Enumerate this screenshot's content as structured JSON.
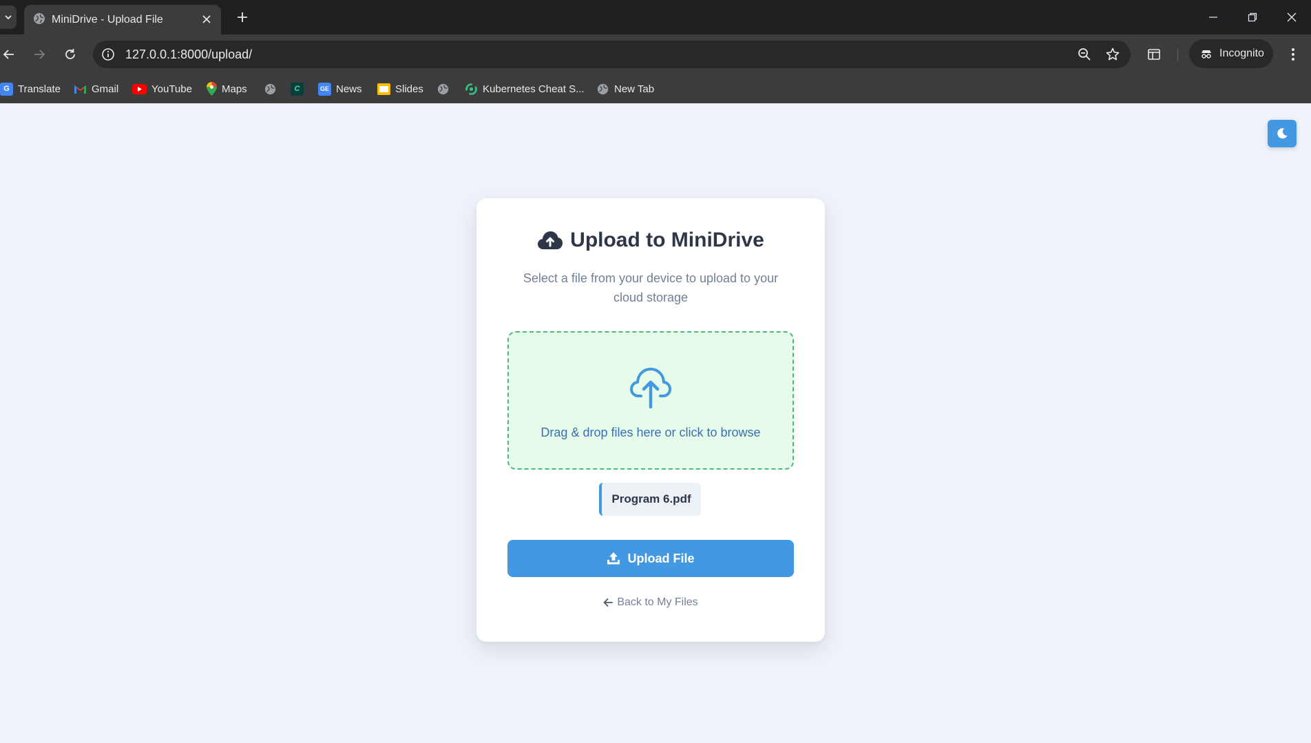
{
  "browser": {
    "tab_title": "MiniDrive - Upload File",
    "url": "127.0.0.1:8000/upload/",
    "incognito_label": "Incognito",
    "bookmarks": [
      {
        "label": "Translate",
        "icon": "google-translate-icon"
      },
      {
        "label": "Gmail",
        "icon": "gmail-icon"
      },
      {
        "label": "YouTube",
        "icon": "youtube-icon"
      },
      {
        "label": "Maps",
        "icon": "maps-icon"
      },
      {
        "label": "",
        "icon": "globe-icon"
      },
      {
        "label": "",
        "icon": "c-logo-icon"
      },
      {
        "label": "News",
        "icon": "google-news-icon"
      },
      {
        "label": "Slides",
        "icon": "slides-icon"
      },
      {
        "label": "",
        "icon": "globe-icon"
      },
      {
        "label": "Kubernetes Cheat S...",
        "icon": "kubernetes-icon"
      },
      {
        "label": "New Tab",
        "icon": "globe-icon"
      }
    ]
  },
  "page": {
    "title": "Upload to MiniDrive",
    "subtitle": "Select a file from your device to upload to your cloud storage",
    "dropzone_text": "Drag & drop files here or click to browse",
    "selected_file": "Program 6.pdf",
    "upload_button": "Upload File",
    "back_link": "Back to My Files",
    "theme_toggle_icon": "moon-icon"
  },
  "colors": {
    "accent": "#4299e1",
    "dropzone_bg": "#e6fbea",
    "dropzone_border": "#48bb78",
    "page_bg": "#eef2f9",
    "heading": "#2d3748"
  }
}
